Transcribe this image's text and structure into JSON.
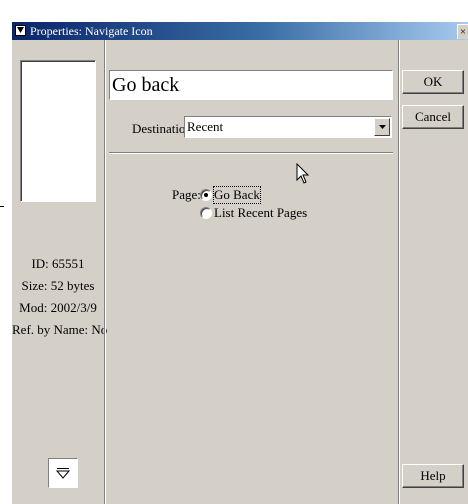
{
  "window": {
    "title": "Properties: Navigate Icon",
    "close_glyph": "×"
  },
  "info": {
    "id": "ID: 65551",
    "size": "Size: 52 bytes",
    "mod": "Mod: 2002/3/9",
    "ref": "Ref. by Name: No"
  },
  "icon_name": "Go back",
  "destination": {
    "label": "Destination:",
    "value": "Recent"
  },
  "page": {
    "label": "Page:",
    "options": [
      "Go Back",
      "List Recent Pages"
    ],
    "selected": "Go Back"
  },
  "buttons": {
    "ok": "OK",
    "cancel": "Cancel",
    "help": "Help"
  },
  "colors": {
    "dialog_bg": "#d4d0c8",
    "title_start": "#0a246a",
    "title_end": "#a6caf0"
  }
}
